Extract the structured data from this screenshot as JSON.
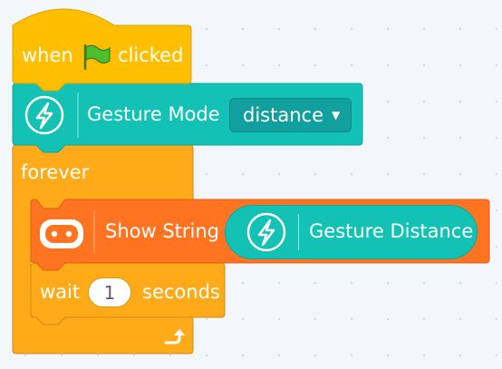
{
  "hat_block": {
    "prefix": "when",
    "flag_icon": "green-flag-icon",
    "suffix": "clicked",
    "color": "#ffbf00"
  },
  "gesture_mode_block": {
    "icon": "lightning-icon",
    "label": "Gesture Mode",
    "selected_option": "distance",
    "color": "#14c2b5"
  },
  "forever_block": {
    "label": "forever",
    "repeat_icon": "loop-arrow-icon",
    "color": "#ffab19"
  },
  "show_string_block": {
    "icon": "microbit-icon",
    "label": "Show String",
    "color": "#ff7321"
  },
  "gesture_distance_reporter": {
    "icon": "lightning-icon",
    "label": "Gesture Distance",
    "color": "#14c2b5"
  },
  "wait_block": {
    "label_before": "wait",
    "value": "1",
    "label_after": "seconds",
    "color": "#ffab19"
  }
}
